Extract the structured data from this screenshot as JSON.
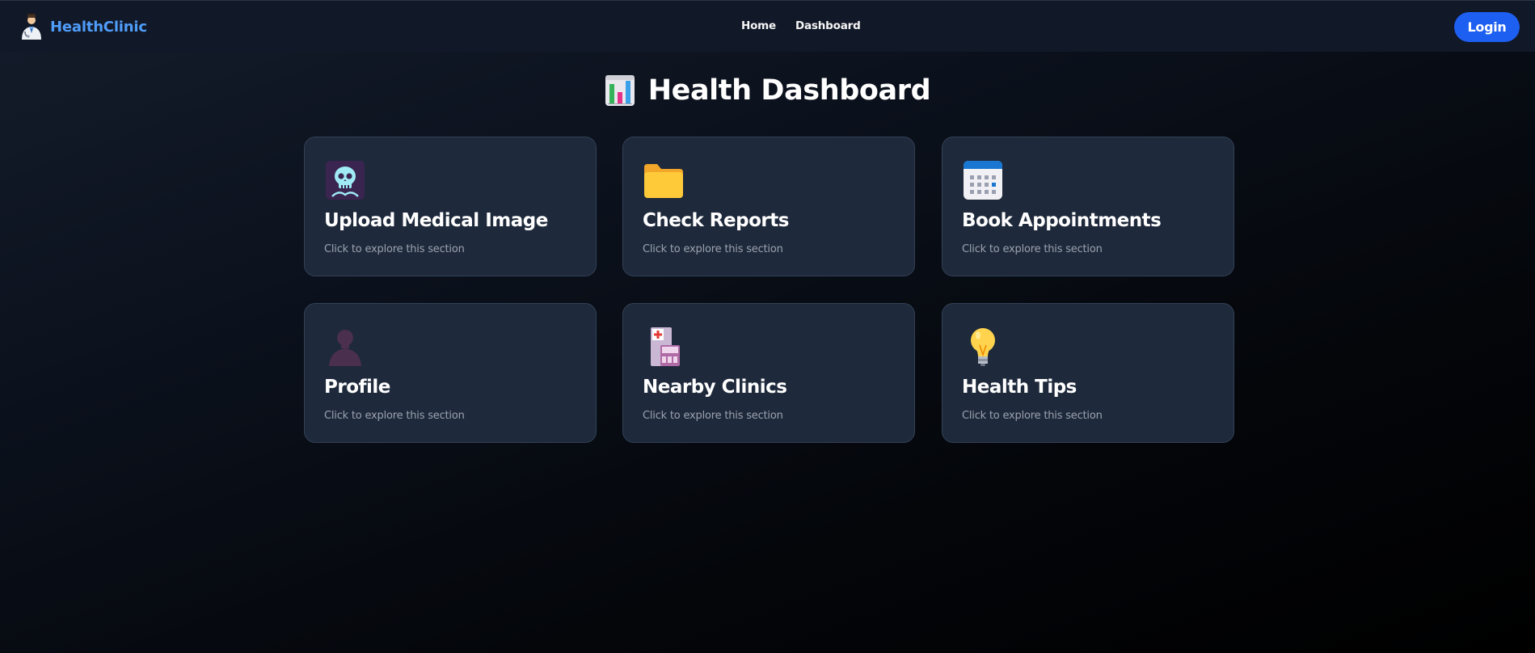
{
  "app": {
    "brand_name": "HealthClinic",
    "brand_icon": "doctor-icon",
    "accent_color": "#4f9cf9"
  },
  "nav": {
    "links": [
      {
        "label": "Home"
      },
      {
        "label": "Dashboard"
      }
    ],
    "login_label": "Login",
    "login_color": "#1d5ff0"
  },
  "page": {
    "title": "Health Dashboard",
    "title_icon": "bar-chart-icon"
  },
  "cards": [
    {
      "title": "Upload Medical Image",
      "subtitle": "Click to explore this section",
      "icon": "x-ray-icon"
    },
    {
      "title": "Check Reports",
      "subtitle": "Click to explore this section",
      "icon": "folder-icon"
    },
    {
      "title": "Book Appointments",
      "subtitle": "Click to explore this section",
      "icon": "calendar-icon"
    },
    {
      "title": "Profile",
      "subtitle": "Click to explore this section",
      "icon": "person-silhouette-icon"
    },
    {
      "title": "Nearby Clinics",
      "subtitle": "Click to explore this section",
      "icon": "hospital-icon"
    },
    {
      "title": "Health Tips",
      "subtitle": "Click to explore this section",
      "icon": "light-bulb-icon"
    }
  ]
}
